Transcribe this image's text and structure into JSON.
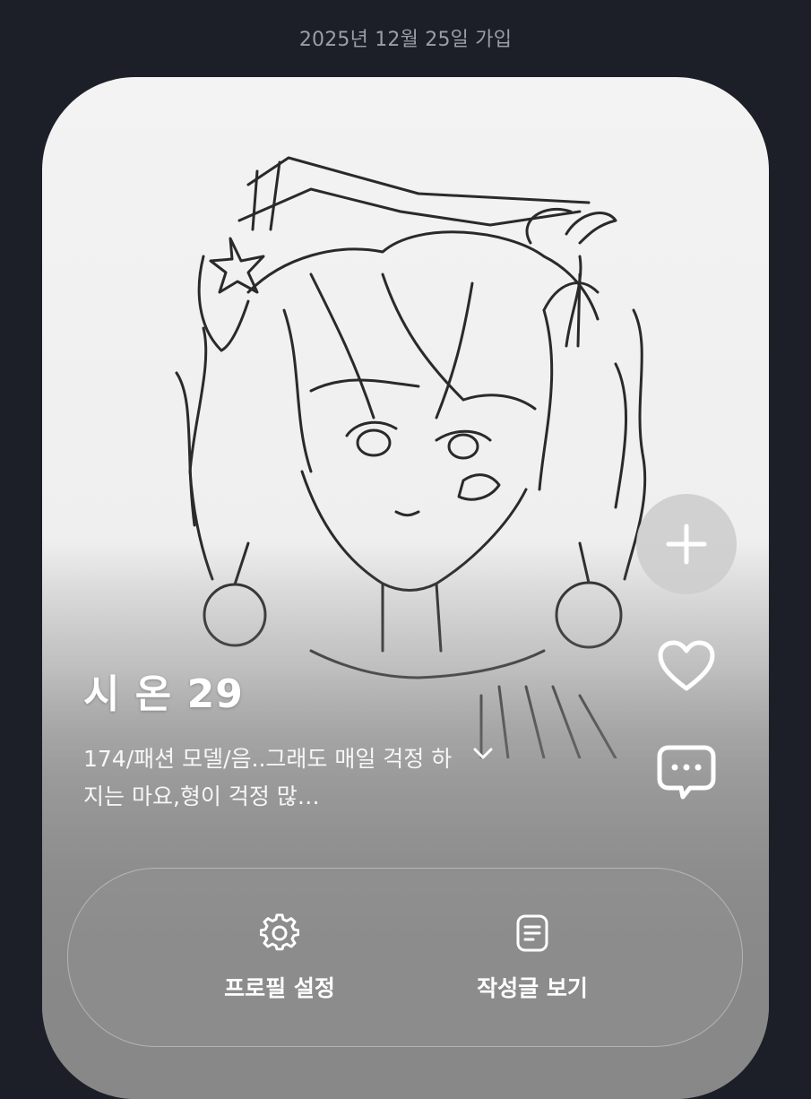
{
  "header": {
    "join_date": "2025년 12월 25일 가입"
  },
  "profile": {
    "name": "시 온 29",
    "bio": "174/패션 모델/음..그래도 매일 걱정 하지는 마요,형이 걱정 많…",
    "image": "pencil-sketch-portrait"
  },
  "side_actions": {
    "add_icon": "plus-icon",
    "like_icon": "heart-icon",
    "comment_icon": "chat-bubble-icon"
  },
  "actions": {
    "settings_label": "프로필 설정",
    "posts_label": "작성글 보기"
  },
  "colors": {
    "background": "#1c1f28",
    "card": "#efefef",
    "text_light": "#ffffff"
  }
}
